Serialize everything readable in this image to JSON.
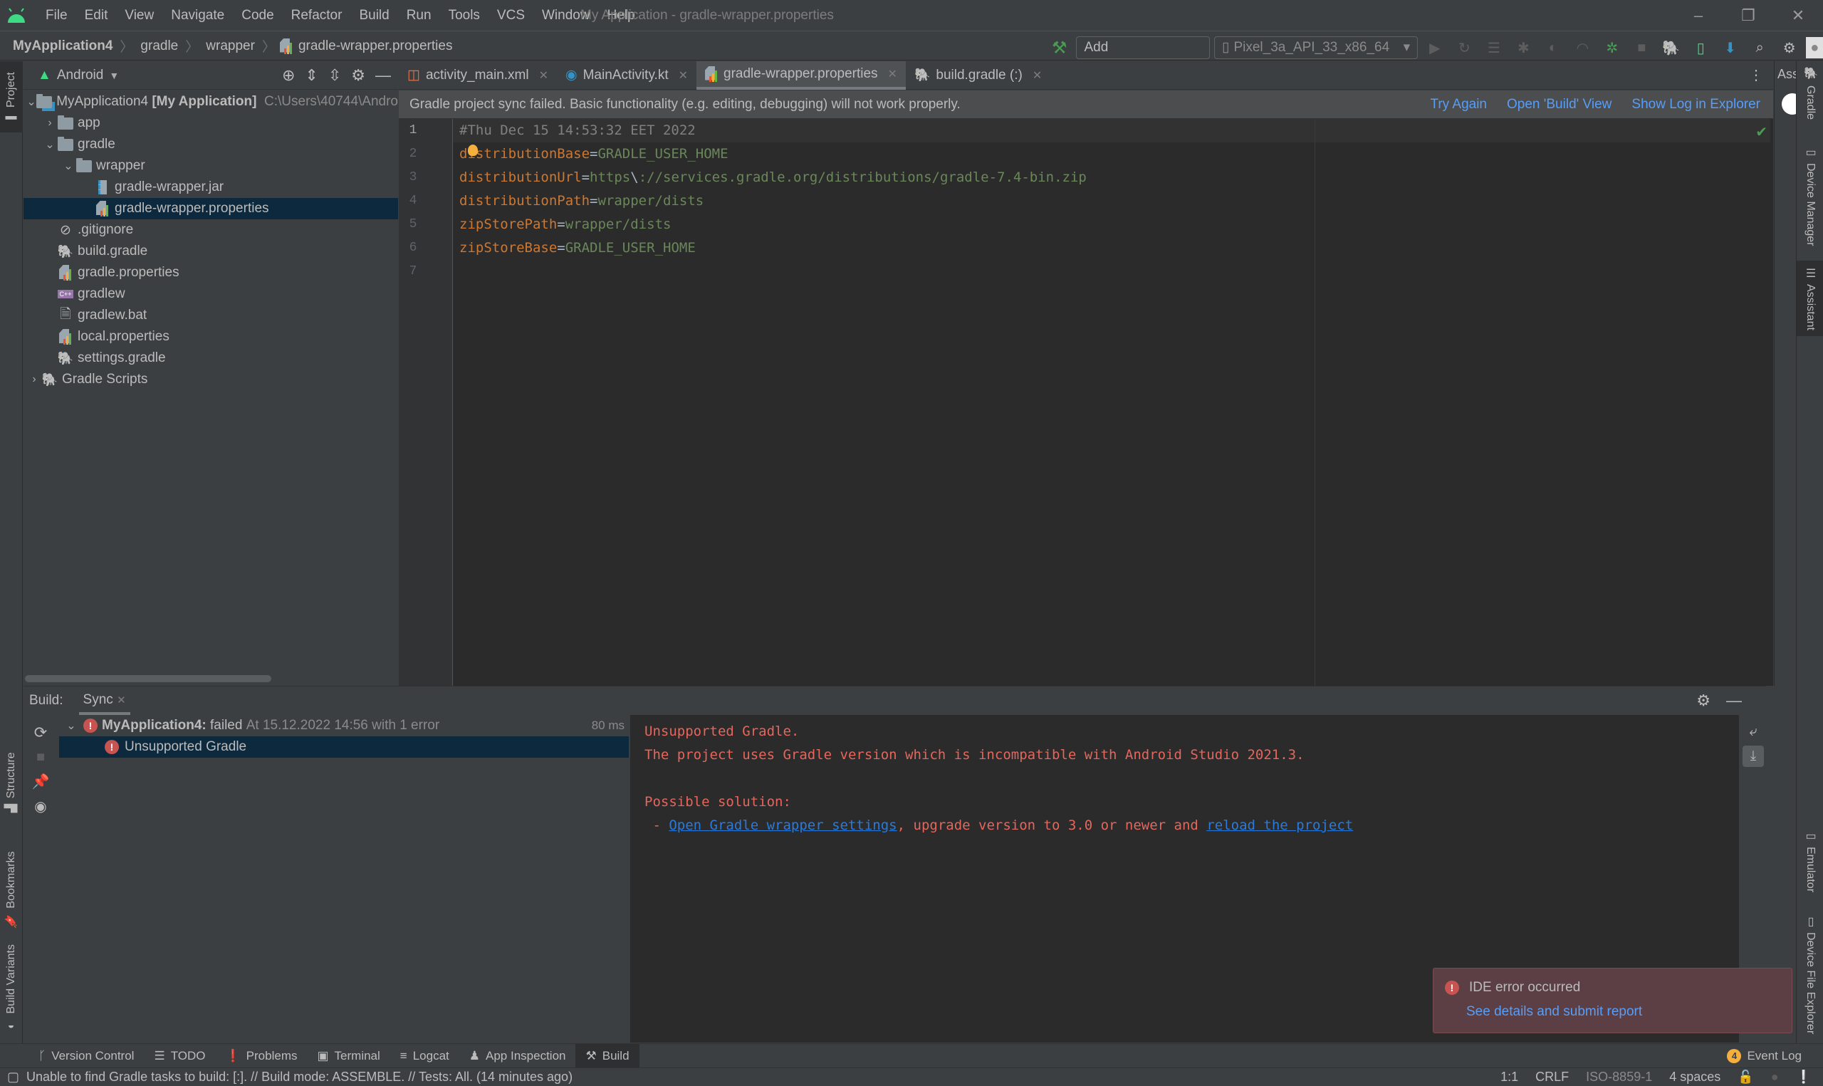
{
  "app": {
    "menu": [
      "File",
      "Edit",
      "View",
      "Navigate",
      "Code",
      "Refactor",
      "Build",
      "Run",
      "Tools",
      "VCS",
      "Window",
      "Help"
    ],
    "window_title": "My Application - gradle-wrapper.properties"
  },
  "navbar": {
    "breadcrumbs": [
      "MyApplication4",
      "gradle",
      "wrapper",
      "gradle-wrapper.properties"
    ],
    "add_config": "Add Configuration...",
    "device": "Pixel_3a_API_33_x86_64"
  },
  "project": {
    "tab_label": "Project",
    "view_selector": "Android",
    "root": {
      "name": "MyApplication4",
      "module": "[My Application]",
      "path": "C:\\Users\\40744\\Andro"
    },
    "items": [
      {
        "label": "app",
        "type": "folder",
        "level": 1,
        "expanded": false
      },
      {
        "label": "gradle",
        "type": "folder",
        "level": 1,
        "expanded": true
      },
      {
        "label": "wrapper",
        "type": "folder",
        "level": 2,
        "expanded": true
      },
      {
        "label": "gradle-wrapper.jar",
        "type": "jar",
        "level": 3
      },
      {
        "label": "gradle-wrapper.properties",
        "type": "properties",
        "level": 3,
        "selected": true
      },
      {
        "label": ".gitignore",
        "type": "ignore",
        "level": 1
      },
      {
        "label": "build.gradle",
        "type": "gradle",
        "level": 1
      },
      {
        "label": "gradle.properties",
        "type": "properties",
        "level": 1
      },
      {
        "label": "gradlew",
        "type": "script",
        "level": 1
      },
      {
        "label": "gradlew.bat",
        "type": "text",
        "level": 1
      },
      {
        "label": "local.properties",
        "type": "properties",
        "level": 1
      },
      {
        "label": "settings.gradle",
        "type": "gradle",
        "level": 1
      }
    ],
    "gradle_scripts": "Gradle Scripts"
  },
  "tabs": [
    {
      "label": "activity_main.xml",
      "active": false
    },
    {
      "label": "MainActivity.kt",
      "active": false
    },
    {
      "label": "gradle-wrapper.properties",
      "active": true
    },
    {
      "label": "build.gradle (:)",
      "active": false
    }
  ],
  "banner": {
    "message": "Gradle project sync failed. Basic functionality (e.g. editing, debugging) will not work properly.",
    "try_again": "Try Again",
    "open_build": "Open 'Build' View",
    "show_log": "Show Log in Explorer"
  },
  "editor": {
    "line_numbers": [
      "1",
      "2",
      "3",
      "4",
      "5",
      "6",
      "7"
    ],
    "lines": [
      {
        "comment": "#Thu Dec 15 14:53:32 EET 2022"
      },
      {
        "key": "distributionBase",
        "value": "GRADLE_USER_HOME"
      },
      {
        "key": "distributionUrl",
        "value_a": "https",
        "esc": "\\",
        "value_b": "://services.gradle.org/distributions/gradle-7.4-bin.zip"
      },
      {
        "key": "distributionPath",
        "value": "wrapper/dists"
      },
      {
        "key": "zipStorePath",
        "value": "wrapper/dists"
      },
      {
        "key": "zipStoreBase",
        "value": "GRADLE_USER_HOME"
      }
    ]
  },
  "build": {
    "label": "Build:",
    "tab": "Sync",
    "root_name": "MyApplication4:",
    "root_status": "failed",
    "root_detail": "At 15.12.2022 14:56 with 1 error",
    "duration": "80 ms",
    "child": "Unsupported Gradle",
    "output": {
      "line1": "Unsupported Gradle.",
      "line2": "The project uses Gradle version which is incompatible with Android Studio 2021.3.",
      "line3": "Possible solution:",
      "prefix": " - ",
      "link1": "Open Gradle wrapper settings",
      "middle": ", upgrade version to 3.0 or newer and ",
      "link2": "reload the project"
    }
  },
  "left_tabs": [
    "Structure",
    "Bookmarks",
    "Build Variants"
  ],
  "right_tabs": [
    "Gradle",
    "Device Manager",
    "Assistant",
    "Emulator",
    "Device File Explorer"
  ],
  "assistant_label": "Assi",
  "notification": {
    "title": "IDE error occurred",
    "link": "See details and submit report"
  },
  "toolwindows": [
    "Version Control",
    "TODO",
    "Problems",
    "Terminal",
    "Logcat",
    "App Inspection",
    "Build"
  ],
  "event_log": {
    "label": "Event Log",
    "count": "4"
  },
  "status": {
    "message": "Unable to find Gradle tasks to build: [:]. // Build mode: ASSEMBLE. // Tests: All. (14 minutes ago)",
    "position": "1:1",
    "line_sep": "CRLF",
    "encoding": "ISO-8859-1",
    "indent": "4 spaces"
  },
  "colors": {
    "accent": "#589df6",
    "error": "#c75450",
    "selection": "#0d293e",
    "android_green": "#3ddc84"
  }
}
